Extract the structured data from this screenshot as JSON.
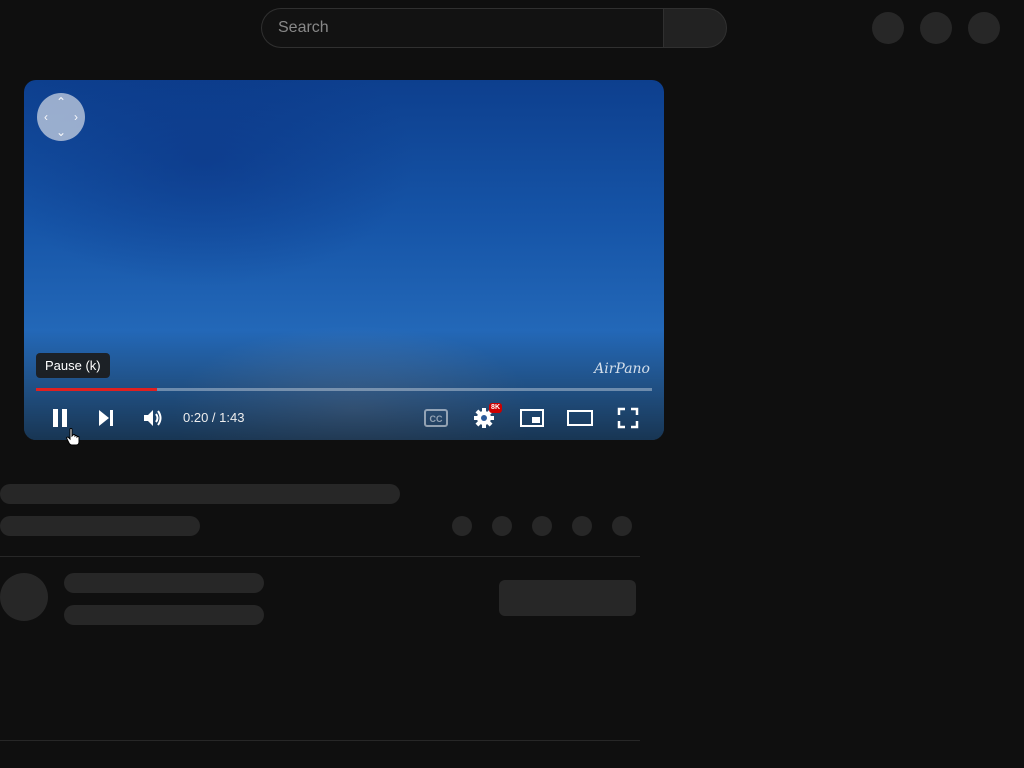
{
  "search": {
    "placeholder": "Search"
  },
  "player": {
    "watermark": "AirPano",
    "tooltip": "Pause (k)",
    "time_display": "0:20 / 1:43",
    "progress_fraction": 0.197,
    "hd_badge": "8K",
    "accent_color": "#e02020",
    "icons": [
      "pause-icon",
      "next-icon",
      "volume-icon",
      "subtitles-icon",
      "settings-icon",
      "miniplayer-icon",
      "theater-mode-icon",
      "fullscreen-icon",
      "360-navigation-icon"
    ]
  }
}
